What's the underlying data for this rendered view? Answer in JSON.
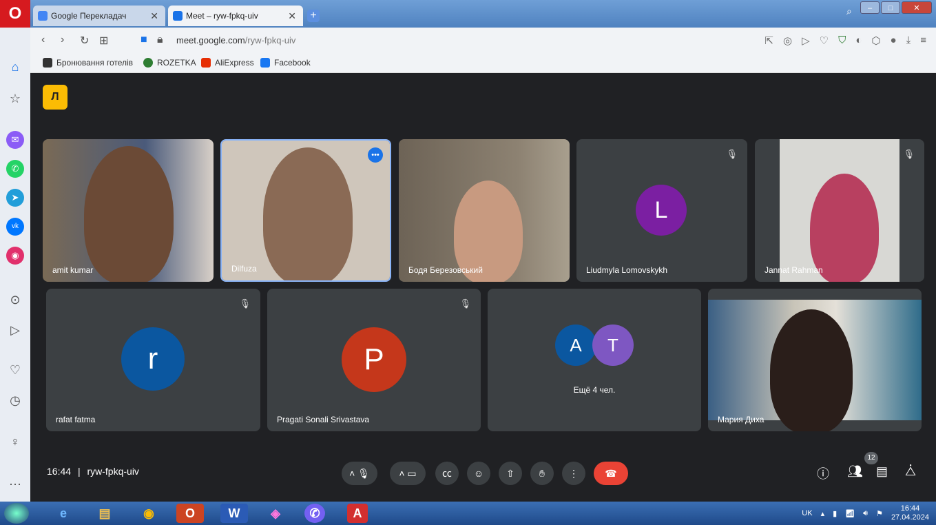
{
  "browser": {
    "tabs": [
      {
        "label": "Google Перекладач"
      },
      {
        "label": "Meet – ryw-fpkq-uiv"
      }
    ],
    "url_host": "meet.google.com",
    "url_path": "/ryw-fpkq-uiv",
    "bookmarks": [
      "Бронювання готелів",
      "ROZETKA",
      "AliExpress",
      "Facebook"
    ]
  },
  "meet": {
    "participants_row1": [
      {
        "name": "amit kumar",
        "type": "video"
      },
      {
        "name": "Dilfuza",
        "type": "video",
        "active": true
      },
      {
        "name": "Бодя Березовський",
        "type": "video"
      },
      {
        "name": "Liudmyla Lomovskykh",
        "type": "avatar",
        "initial": "L",
        "color": "#7b1fa2",
        "muted": true
      },
      {
        "name": "Jannat Rahman",
        "type": "video",
        "muted": true
      }
    ],
    "participants_row2": [
      {
        "name": "rafat fatma",
        "type": "avatar",
        "initial": "r",
        "color": "#0b57a0",
        "muted": true
      },
      {
        "name": "Pragati Sonali Srivastava",
        "type": "avatar",
        "initial": "P",
        "color": "#c5371b",
        "muted": true
      },
      {
        "name": "Мария Диха",
        "type": "video"
      }
    ],
    "group_tile": {
      "initials": [
        "A",
        "T"
      ],
      "colors": [
        "#0b57a0",
        "#7e57c2"
      ],
      "more_label": "Ещё 4 чел."
    },
    "time": "16:44",
    "separator": "|",
    "code": "ryw-fpkq-uiv",
    "participant_count": "12"
  },
  "taskbar": {
    "language": "UK",
    "clock_time": "16:44",
    "clock_date": "27.04.2024"
  }
}
